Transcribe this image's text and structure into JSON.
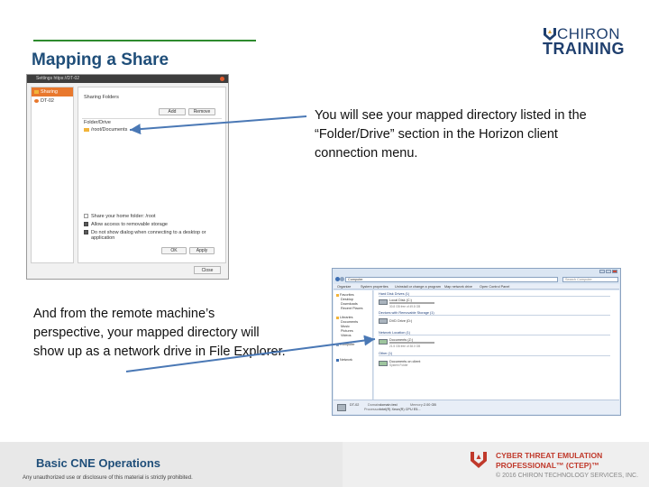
{
  "slide": {
    "title": "Mapping a Share",
    "callout_1": "You will see your mapped directory listed in the “Folder/Drive” section in the Horizon client connection menu.",
    "callout_2": "And from the remote machine’s perspective, your mapped directory will show up as a network drive in File Explorer."
  },
  "logo": {
    "line1": "CHIRON",
    "line2": "TRAINING"
  },
  "settings_dialog": {
    "window_title": "Settings https://DT-02",
    "sidebar": [
      {
        "label": "Sharing",
        "selected": true
      },
      {
        "label": "DT-02",
        "selected": false
      }
    ],
    "section_title": "Sharing Folders",
    "add_label": "Add",
    "remove_label": "Remove",
    "folder_header": "Folder/Drive",
    "folder_entry": "/root/Documents",
    "options": [
      {
        "label": "Share your home folder: /root",
        "checked": false
      },
      {
        "label": "Allow access to removable storage",
        "checked": true
      },
      {
        "label": "Do not show dialog when connecting to a desktop or application",
        "checked": true
      }
    ],
    "ok_label": "OK",
    "apply_label": "Apply",
    "close_label": "Close"
  },
  "explorer": {
    "address": "Computer",
    "search_placeholder": "Search Computer",
    "commands": [
      "Organize",
      "System properties",
      "Uninstall or change a program",
      "Map network drive",
      "Open Control Panel"
    ],
    "nav": {
      "favorites": "Favorites",
      "favorites_items": [
        "Desktop",
        "Downloads",
        "Recent Places"
      ],
      "libraries": "Libraries",
      "libraries_items": [
        "Documents",
        "Music",
        "Pictures",
        "Videos"
      ],
      "computer": "Computer",
      "network": "Network"
    },
    "groups": {
      "hdd": "Hard Disk Drives (1)",
      "removable": "Devices with Removable Storage (1)",
      "network": "Network Location (1)",
      "other": "Other (1)"
    },
    "drives": {
      "local_name": "Local Disk (C:)",
      "local_free": "30.8 GB free of 49.8 GB",
      "local_fill": 0.38,
      "dvd_name": "DVD Drive (D:)",
      "net_name": "Documents (Z:)",
      "net_free": "21.5 GB free of 38.0 GB",
      "net_fill": 0.43,
      "other_name": "Documents on client",
      "other_sub": "System Folder"
    },
    "status": {
      "name": "DT-02",
      "domain_label": "Domain:",
      "domain_value": "domain.test",
      "memory_label": "Memory:",
      "memory_value": "2.00 GB",
      "processor_label": "Processor:",
      "processor_value": "Intel(R) Xeon(R) CPU E5..."
    }
  },
  "footer": {
    "title": "Basic CNE Operations",
    "note": "Any unauthorized use or disclosure of this material is strictly prohibited.",
    "brand_line1": "CYBER THREAT EMULATION",
    "brand_line2": "PROFESSIONAL™ (CTEP)™",
    "copyright": "© 2016 CHIRON TECHNOLOGY SERVICES, INC."
  },
  "colors": {
    "title_blue": "#1f4e79",
    "rule_green": "#2e8b2e",
    "accent_orange": "#e8782d",
    "arrow_blue": "#4a78b5",
    "brand_red": "#c0392b"
  }
}
